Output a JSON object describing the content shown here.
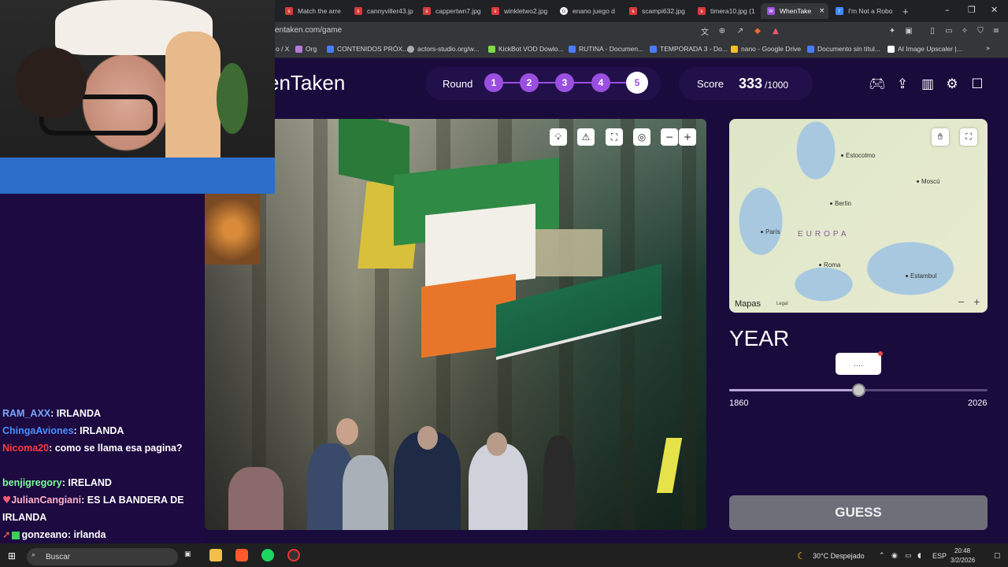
{
  "browser": {
    "tabs": [
      {
        "label": "Match the arre"
      },
      {
        "label": "cannyviller43.jp"
      },
      {
        "label": "cappertwn7.jpg"
      },
      {
        "label": "winkletwo2.jpg"
      },
      {
        "label": "enano juego d"
      },
      {
        "label": "scampi632.jpg"
      },
      {
        "label": "timera10.jpg (1"
      },
      {
        "label": "WhenTake"
      },
      {
        "label": "I'm Not a Robo"
      }
    ],
    "active_tab_close": "×",
    "new_tab": "+",
    "url": "entaken.com/game",
    "bookmarks": [
      "o / X",
      "Org",
      "CONTENIDOS PRÓX...",
      "actors-studio.org/w...",
      "KickBot VOD Dowlo...",
      "RUTINA - Documen...",
      "TEMPORADA 3 - Do...",
      "nano - Google Drive",
      "Documento sin títul...",
      "AI Image Upscaler |..."
    ]
  },
  "header": {
    "logo": "enTaken",
    "round_label": "Round",
    "rounds": [
      "1",
      "2",
      "3",
      "4",
      "5"
    ],
    "current_round": "5",
    "score_label": "Score",
    "score_value": "333",
    "score_max": "/1000"
  },
  "map": {
    "cities": [
      "Estocolmo",
      "Moscú",
      "Berlín",
      "París",
      "Roma",
      "Estambul"
    ],
    "region": "EUROPA",
    "brand": "Mapas",
    "legal": "Legal",
    "zoom_out": "−",
    "zoom_in": "+"
  },
  "year": {
    "title": "YEAR",
    "bubble": "....",
    "min": "1860",
    "max": "2026",
    "slider_fraction": 0.5
  },
  "guess_label": "GUESS",
  "chat": [
    {
      "user": "RAM_AXX",
      "text": ": IRLANDA",
      "color": "#7aa7ff"
    },
    {
      "user": "ChingaAviones",
      "text": ": IRLANDA",
      "color": "#4a90ff"
    },
    {
      "user": "Nicoma20",
      "text": ": como se llama esa pagina?",
      "color": "#ff3b3b"
    },
    {
      "user": "benjigregory",
      "text": ": IRELAND",
      "color": "#7cff9a"
    },
    {
      "user": "JulianCangiani",
      "text": ": ES LA BANDERA DE IRLANDA",
      "color": "#ffb3c7"
    },
    {
      "user": "gonzeano",
      "text": ": irlanda",
      "color": "#ffffff"
    }
  ],
  "taskbar": {
    "search": "Buscar",
    "weather": "30°C  Despejado",
    "lang": "ESP",
    "time": "20:48",
    "date": "3/2/2026"
  }
}
